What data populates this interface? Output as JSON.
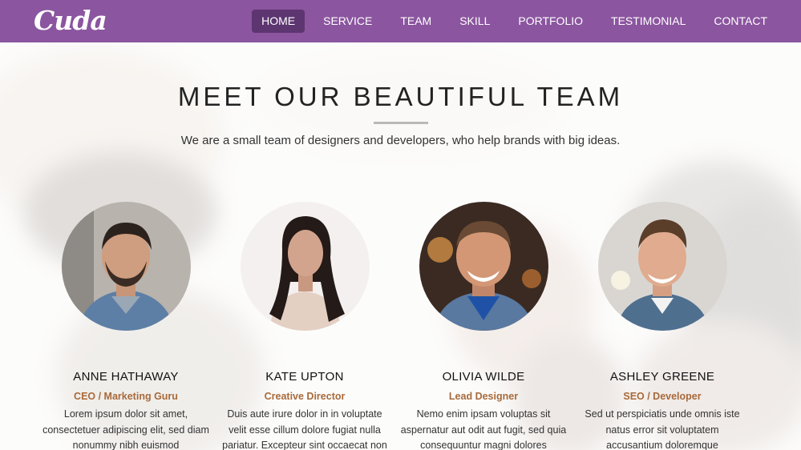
{
  "brand": {
    "logo_text": "Cuda"
  },
  "nav": {
    "items": [
      {
        "label": "HOME",
        "active": true
      },
      {
        "label": "SERVICE",
        "active": false
      },
      {
        "label": "TEAM",
        "active": false
      },
      {
        "label": "SKILL",
        "active": false
      },
      {
        "label": "PORTFOLIO",
        "active": false
      },
      {
        "label": "TESTIMONIAL",
        "active": false
      },
      {
        "label": "CONTACT",
        "active": false
      }
    ]
  },
  "team_section": {
    "title": "MEET OUR BEAUTIFUL TEAM",
    "subtitle": "We are a small team of designers and developers, who help brands with big ideas.",
    "members": [
      {
        "name": "ANNE HATHAWAY",
        "role": "CEO / Marketing Guru",
        "bio": "Lorem ipsum dolor sit amet, consectetuer adipiscing elit, sed diam nonummy nibh euismod"
      },
      {
        "name": "KATE UPTON",
        "role": "Creative Director",
        "bio": "Duis aute irure dolor in in voluptate velit esse cillum dolore fugiat nulla pariatur. Excepteur sint occaecat non"
      },
      {
        "name": "OLIVIA WILDE",
        "role": "Lead Designer",
        "bio": "Nemo enim ipsam voluptas sit aspernatur aut odit aut fugit, sed quia consequuntur magni dolores"
      },
      {
        "name": "ASHLEY GREENE",
        "role": "SEO / Developer",
        "bio": "Sed ut perspiciatis unde omnis iste natus error sit voluptatem accusantium doloremque"
      }
    ]
  },
  "colors": {
    "nav_bg": "#8b559f",
    "nav_active": "#5d3570",
    "role_text": "#a86a3a",
    "title_text": "#222222"
  }
}
